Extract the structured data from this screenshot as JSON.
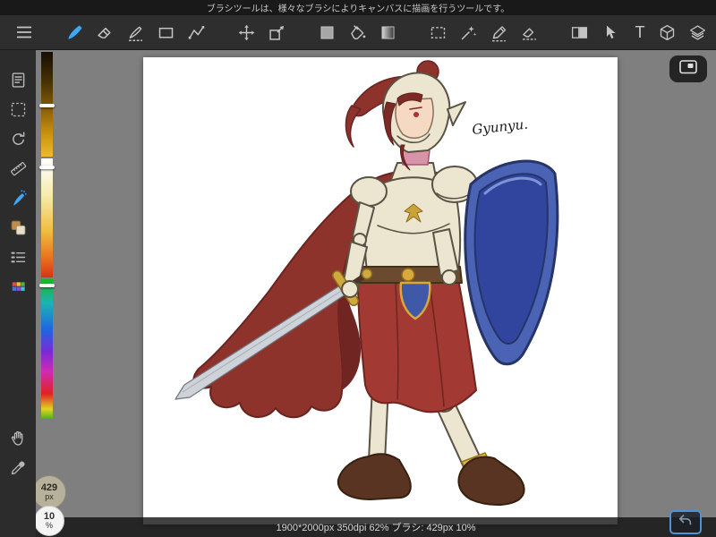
{
  "header": {
    "tooltip": "ブラシツールは、様々なブラシによりキャンバスに描画を行うツールです。"
  },
  "toolbar": {
    "text_tool_label": "T",
    "tool_icons": [
      "menu-icon",
      "brush-icon",
      "eraser-icon",
      "select-pen-icon",
      "shape-rect-icon",
      "polyline-icon",
      "move-icon",
      "transform-icon",
      "fill-rect-icon",
      "paint-bucket-icon",
      "gradient-icon",
      "marquee-select-icon",
      "magic-wand-icon",
      "draw-select-icon",
      "erase-select-icon",
      "split-view-icon",
      "cursor-select-icon",
      "text-tool-icon",
      "material-cube-icon",
      "layers-icon"
    ]
  },
  "sidebar": {
    "tool_icons": [
      "document-icon",
      "select-area-icon",
      "rotate-canvas-icon",
      "ruler-icon",
      "airbrush-icon",
      "color-swatches-icon",
      "brush-list-icon",
      "pixel-palette-icon",
      "hand-icon",
      "eyedropper-icon"
    ],
    "brush_size_value": "429",
    "brush_size_unit": "px",
    "brush_opacity_value": "10",
    "brush_opacity_unit": "%"
  },
  "canvas": {
    "signature": "Gyunyu."
  },
  "status": {
    "info": "1900*2000px 350dpi 62% ブラシ: 429px 10%"
  },
  "colors": {
    "accent_blue": "#3da8f5",
    "workspace_gray": "#7f7f7f",
    "cape_red": "#8e322c",
    "shield_blue": "#4058a8",
    "armor_cream": "#ece5cf"
  }
}
